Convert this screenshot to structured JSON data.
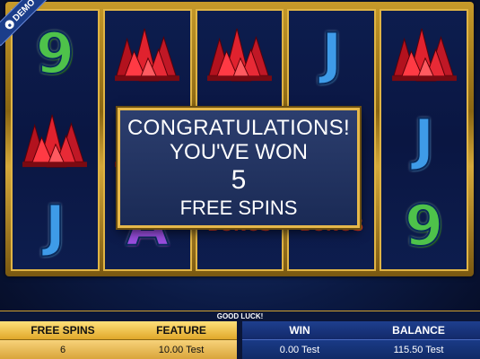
{
  "badge": {
    "label": "DEMO"
  },
  "reels": [
    {
      "symbols": [
        {
          "type": "letter",
          "value": "9",
          "color": "#4ec24a"
        },
        {
          "type": "crystal"
        },
        {
          "type": "letter",
          "value": "J",
          "color": "#3e9be8"
        }
      ]
    },
    {
      "symbols": [
        {
          "type": "crystal"
        },
        {
          "type": "crystal"
        },
        {
          "type": "letter",
          "value": "A",
          "color": "#9a4ee0"
        }
      ]
    },
    {
      "symbols": [
        {
          "type": "crystal"
        },
        {
          "type": "hidden"
        },
        {
          "type": "bonus",
          "value": "BONUS"
        }
      ]
    },
    {
      "symbols": [
        {
          "type": "letter",
          "value": "J",
          "color": "#3e9be8"
        },
        {
          "type": "hidden"
        },
        {
          "type": "bonus",
          "value": "BONUS"
        }
      ]
    },
    {
      "symbols": [
        {
          "type": "crystal"
        },
        {
          "type": "letter",
          "value": "J",
          "color": "#3e9be8"
        },
        {
          "type": "letter",
          "value": "9",
          "color": "#4ec24a"
        }
      ]
    }
  ],
  "dialog": {
    "line1": "CONGRATULATIONS!",
    "line2": "YOU'VE WON",
    "count": "5",
    "line3": "FREE SPINS"
  },
  "message": "GOOD LUCK!",
  "panel": {
    "free_spins": {
      "label": "FREE SPINS",
      "value": "6"
    },
    "feature": {
      "label": "FEATURE",
      "value": "10.00 Test"
    },
    "win": {
      "label": "WIN",
      "value": "0.00 Test"
    },
    "balance": {
      "label": "BALANCE",
      "value": "115.50 Test"
    }
  },
  "colors": {
    "frame_gold": "#e0b444",
    "crystal_red": "#e0222e",
    "panel_blue": "#13296a"
  }
}
